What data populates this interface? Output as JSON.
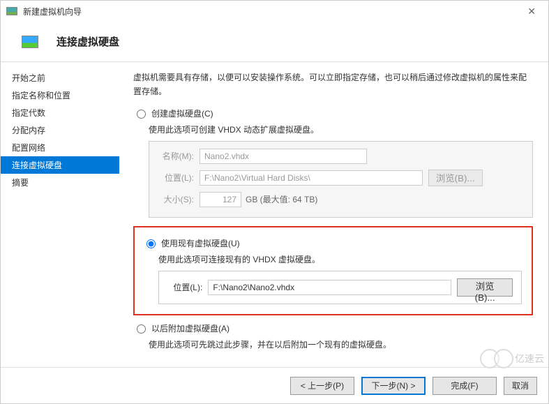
{
  "title": "新建虚拟机向导",
  "header_title": "连接虚拟硬盘",
  "sidebar": {
    "items": [
      "开始之前",
      "指定名称和位置",
      "指定代数",
      "分配内存",
      "配置网络",
      "连接虚拟硬盘",
      "摘要"
    ],
    "active_index": 5
  },
  "intro": "虚拟机需要具有存储，以便可以安装操作系统。可以立即指定存储，也可以稍后通过修改虚拟机的属性来配置存储。",
  "opt1": {
    "label": "创建虚拟硬盘(C)",
    "desc": "使用此选项可创建 VHDX 动态扩展虚拟硬盘。",
    "name_label": "名称(M):",
    "name_value": "Nano2.vhdx",
    "loc_label": "位置(L):",
    "loc_value": "F:\\Nano2\\Virtual Hard Disks\\",
    "size_label": "大小(S):",
    "size_value": "127",
    "size_suffix": "GB (最大值: 64 TB)",
    "browse": "浏览(B)..."
  },
  "opt2": {
    "label": "使用现有虚拟硬盘(U)",
    "desc": "使用此选项可连接现有的 VHDX 虚拟硬盘。",
    "loc_label": "位置(L):",
    "loc_value": "F:\\Nano2\\Nano2.vhdx",
    "browse": "浏览(B)..."
  },
  "opt3": {
    "label": "以后附加虚拟硬盘(A)",
    "desc": "使用此选项可先跳过此步骤，并在以后附加一个现有的虚拟硬盘。"
  },
  "footer": {
    "prev": "< 上一步(P)",
    "next": "下一步(N) >",
    "finish": "完成(F)",
    "cancel": "取消"
  },
  "watermark": "亿速云"
}
